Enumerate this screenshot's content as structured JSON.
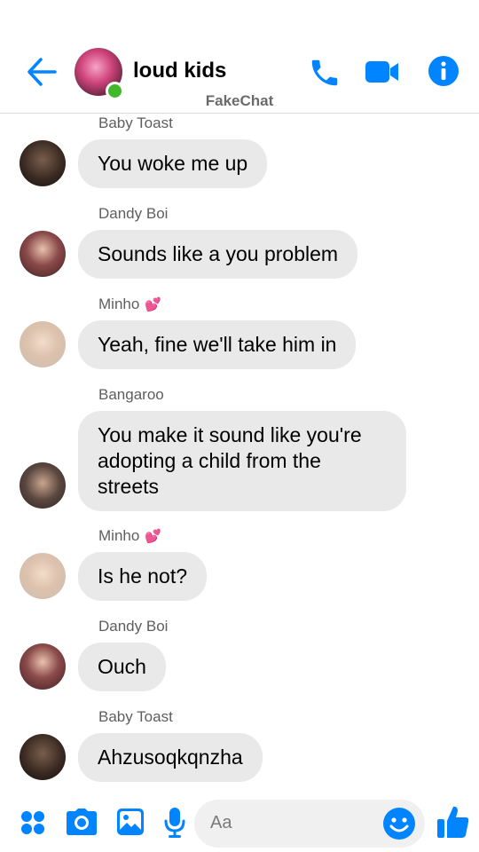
{
  "header": {
    "title": "loud kids",
    "watermark": "FakeChat"
  },
  "messages": [
    {
      "sender": "Baby Toast",
      "text": "You woke me up",
      "heart": false
    },
    {
      "sender": "Dandy Boi",
      "text": "Sounds like a you problem",
      "heart": false
    },
    {
      "sender": "Minho",
      "text": "Yeah, fine we'll take him in",
      "heart": true
    },
    {
      "sender": "Bangaroo",
      "text": "You make it sound like you're adopting a child from the streets",
      "heart": false
    },
    {
      "sender": "Minho",
      "text": "Is he not?",
      "heart": true
    },
    {
      "sender": "Dandy Boi",
      "text": "Ouch",
      "heart": false
    },
    {
      "sender": "Baby Toast",
      "text": "Ahzusoqkqnzha",
      "heart": false
    }
  ],
  "composer": {
    "placeholder": "Aa"
  },
  "colors": {
    "accent": "#0084ff",
    "bubble": "#e9e9e9",
    "online": "#42b72a",
    "heart": "#e0408a"
  },
  "icons": [
    "back-arrow-icon",
    "phone-icon",
    "video-camera-icon",
    "info-icon",
    "apps-grid-icon",
    "camera-icon",
    "image-icon",
    "microphone-icon",
    "emoji-icon",
    "thumbs-up-icon"
  ]
}
